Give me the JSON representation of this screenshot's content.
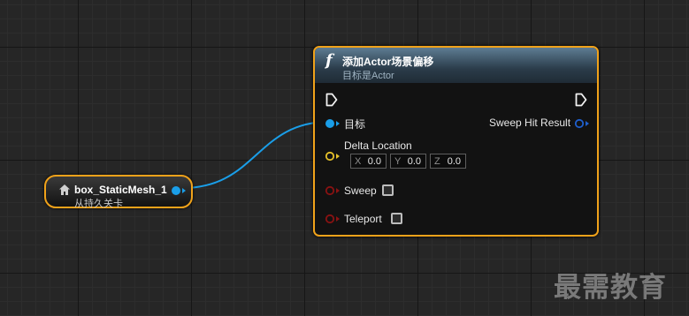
{
  "variable_node": {
    "name": "box_StaticMesh_1",
    "subtitle": "从持久关卡"
  },
  "function_node": {
    "icon": "f",
    "title": "添加Actor场景偏移",
    "subtitle": "目标是Actor",
    "inputs": {
      "target": "目标",
      "delta_location": "Delta Location",
      "sweep": "Sweep",
      "teleport": "Teleport"
    },
    "outputs": {
      "sweep_hit_result": "Sweep Hit Result"
    },
    "vector": {
      "x_label": "X",
      "x_value": "0.0",
      "y_label": "Y",
      "y_value": "0.0",
      "z_label": "Z",
      "z_value": "0.0"
    },
    "checkboxes": {
      "sweep": false,
      "teleport": false
    }
  },
  "watermark": "最需教育",
  "colors": {
    "node_border": "#f0a21a",
    "object_pin": "#1a9ee8",
    "vector_pin": "#e6c12a",
    "bool_pin": "#8a1212",
    "struct_pin": "#1f5fcc",
    "wire": "#1a9ee8"
  }
}
